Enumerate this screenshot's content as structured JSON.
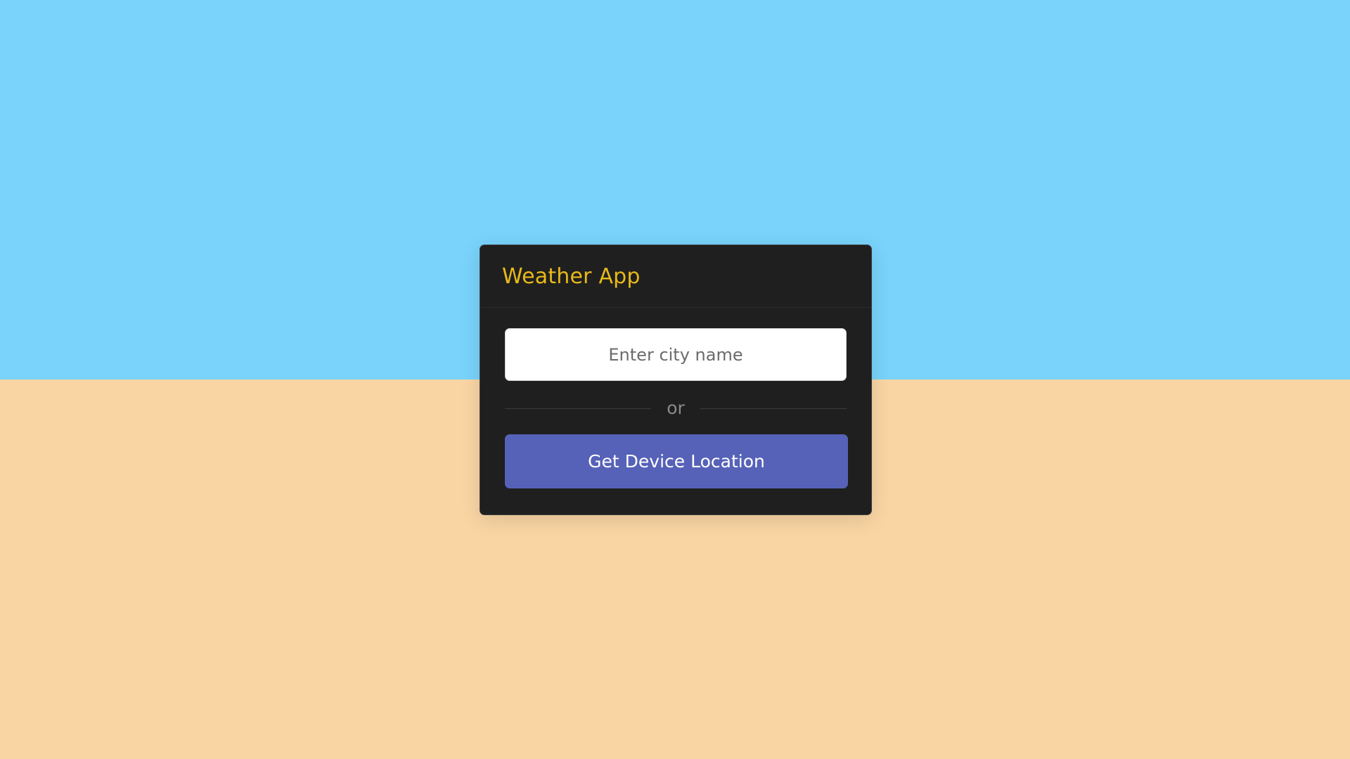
{
  "app": {
    "title": "Weather App"
  },
  "search": {
    "placeholder": "Enter city name",
    "value": ""
  },
  "separator": {
    "label": "or"
  },
  "location": {
    "button_label": "Get Device Location"
  },
  "colors": {
    "sky": "#79d3fb",
    "sand": "#f9d5a4",
    "card": "#1f1f1f",
    "title_accent": "#e8b91a",
    "button": "#5662b8"
  }
}
